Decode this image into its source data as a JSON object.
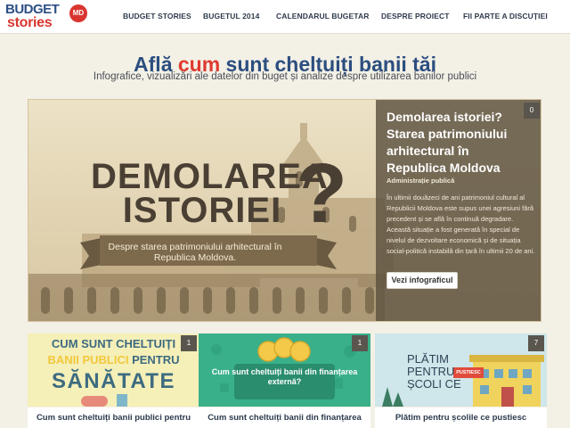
{
  "brand": {
    "line1": "BUDGET",
    "line2": "stories",
    "tag": "MD"
  },
  "nav": [
    "BUDGET STORIES",
    "BUGETUL 2014",
    "CALENDARUL BUGETAR",
    "DESPRE PROIECT",
    "FII PARTE A DISCUȚIEI"
  ],
  "hero": {
    "title_pre": "Află ",
    "title_accent": "cum",
    "title_post": " sunt cheltuiți banii tăi",
    "subtitle": "Infografice, vizualizări ale datelor din buget și analize despre utilizarea banilor publici"
  },
  "feature": {
    "image_title_1": "DEMOLAREA",
    "image_title_2": "ISTORIEI",
    "image_qmark": "?",
    "image_ribbon": "Despre starea patrimoniului arhitectural în Republica Moldova.",
    "badge": "0",
    "title": "Demolarea istoriei? Starea patrimoniului arhitectural în Republica Moldova",
    "category": "Administrație publică",
    "description": "În ultimii douăzeci de ani patrimoniul cultural al Republicii Moldova este supus unei agresiuni fără precedent și se află în continuă degradare. Această situație a fost generată în special de nivelul de dezvoltare economică și de situația social-politică instabilă din țară în ultimii 20 de ani.",
    "button": "Vezi infograficul"
  },
  "cards": [
    {
      "badge": "1",
      "art_line1": "CUM SUNT CHELTUIȚI",
      "art_line2_accent": "BANII PUBLICI",
      "art_line2_rest": " PENTRU",
      "art_line3": "SĂNĂTATE",
      "caption": "Cum sunt cheltuiți banii publici pentru",
      "color": "#f5efb8"
    },
    {
      "badge": "1",
      "art_text": "Cum sunt cheltuiți banii din finanțarea externă?",
      "caption": "Cum sunt cheltuiți banii din finanțarea",
      "color": "#39b08a"
    },
    {
      "badge": "7",
      "art_text": "PLĂTIM PENTRU ȘCOLI CE",
      "art_sign": "PUSTIESC",
      "caption": "Plătim pentru școlile ce pustiesc",
      "color": "#cfe6ea"
    }
  ],
  "colors": {
    "brand_blue": "#2b4e7f",
    "brand_red": "#e0392f",
    "page_bg": "#f3f0e6"
  }
}
